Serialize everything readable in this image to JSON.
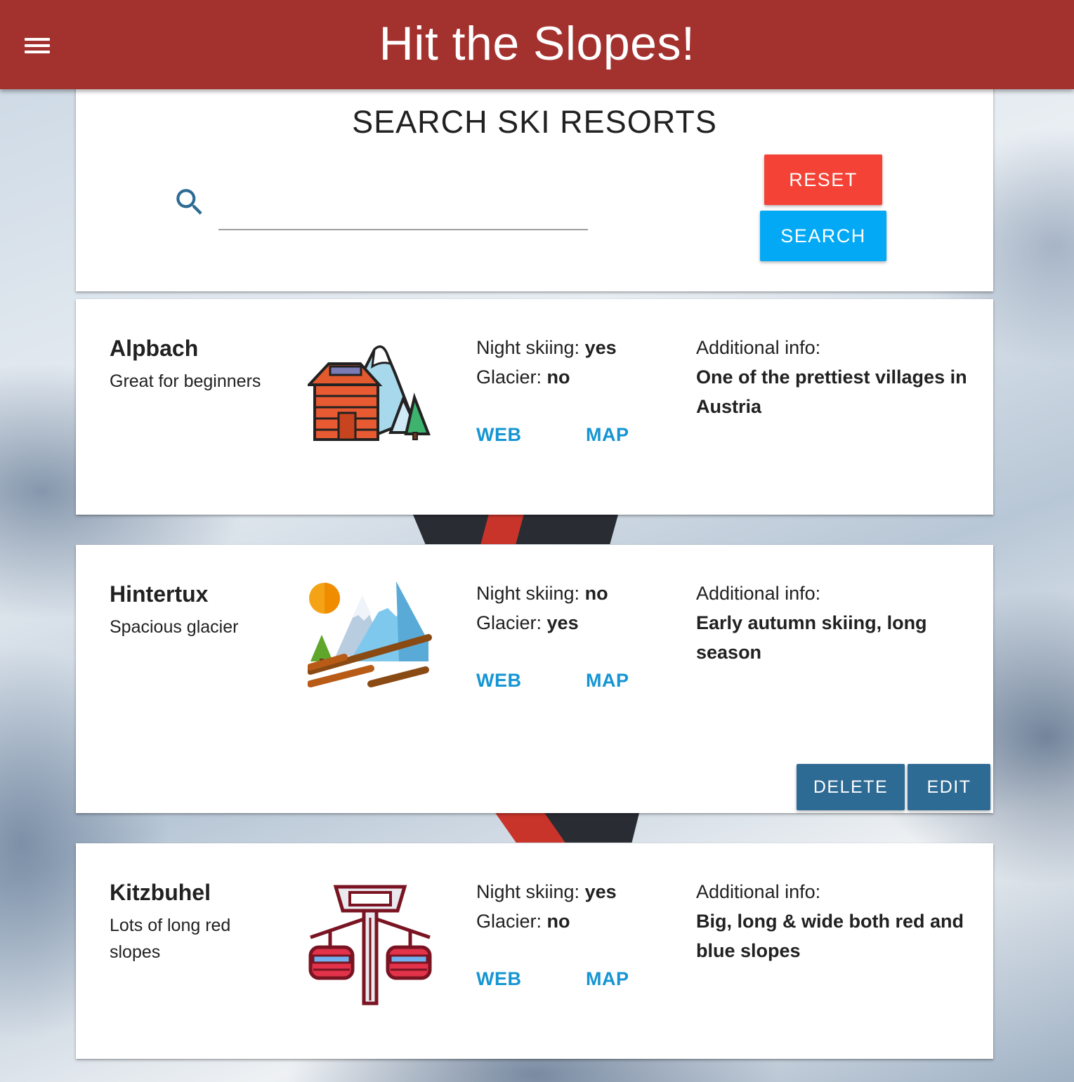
{
  "app": {
    "title": "Hit the Slopes!"
  },
  "search": {
    "heading": "SEARCH SKI RESORTS",
    "value": "",
    "reset_label": "RESET",
    "submit_label": "SEARCH"
  },
  "resorts": [
    {
      "name": "Alpbach",
      "description": "Great for beginners",
      "night_label": "Night skiing: ",
      "night_value": "yes",
      "glacier_label": "Glacier: ",
      "glacier_value": "no",
      "web_label": "WEB",
      "map_label": "MAP",
      "additional_label": "Additional info:",
      "additional_text": "One of the prettiest villages in Austria",
      "icon": "mountain-cabin-icon"
    },
    {
      "name": "Hintertux",
      "description": "Spacious glacier",
      "night_label": "Night skiing: ",
      "night_value": "no",
      "glacier_label": "Glacier: ",
      "glacier_value": "yes",
      "web_label": "WEB",
      "map_label": "MAP",
      "additional_label": "Additional info:",
      "additional_text": "Early autumn skiing, long season",
      "icon": "snowy-mountains-slope-icon",
      "delete_label": "DELETE",
      "edit_label": "EDIT"
    },
    {
      "name": "Kitzbuhel",
      "description": "Lots of long red slopes",
      "night_label": "Night skiing: ",
      "night_value": "yes",
      "glacier_label": "Glacier: ",
      "glacier_value": "no",
      "web_label": "WEB",
      "map_label": "MAP",
      "additional_label": "Additional info:",
      "additional_text": "Big, long & wide both red and blue slopes",
      "icon": "cable-car-icon"
    }
  ],
  "colors": {
    "appbar": "#a3322f",
    "reset": "#f44336",
    "search": "#03a9f4",
    "link": "#1595d3",
    "action": "#2d6a94"
  }
}
